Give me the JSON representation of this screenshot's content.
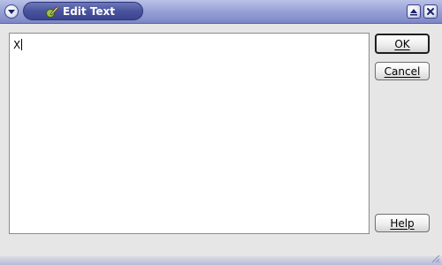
{
  "window": {
    "title": "Edit Text",
    "colors": {
      "titlebar": "#9aa4d8",
      "title_pill": "#4a549e",
      "dialog_bg": "#e6e6e6"
    },
    "icons": {
      "window_menu": "chevron-down-icon",
      "app": "edit-text-app-icon",
      "maximize": "maximize-icon",
      "close": "close-icon"
    }
  },
  "editor": {
    "value": "X"
  },
  "buttons": {
    "ok": "OK",
    "cancel": "Cancel",
    "help": "Help"
  }
}
